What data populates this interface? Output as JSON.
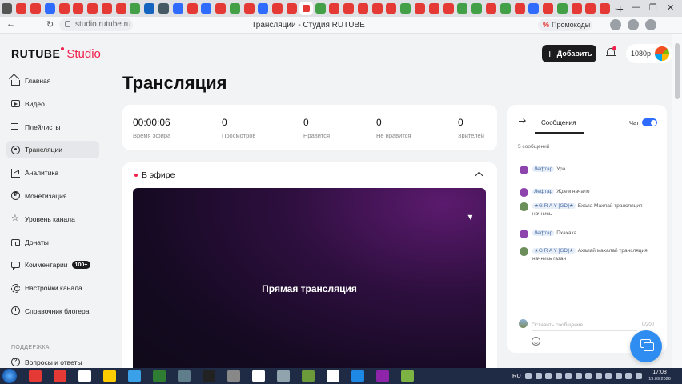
{
  "browser": {
    "tab_colors": [
      "#555",
      "#e53935",
      "#e53935",
      "#2f6bff",
      "#e53935",
      "#e53935",
      "#e53935",
      "#e53935",
      "#e53935",
      "#43a047",
      "#1565c0",
      "#455a64",
      "#2f6bff",
      "#e53935",
      "#2f6bff",
      "#e53935",
      "#43a047",
      "#e53935",
      "#2f6bff",
      "#e53935",
      "#e53935",
      "#e53935",
      "#43a047",
      "#e53935",
      "#e53935",
      "#e53935",
      "#e53935",
      "#e53935",
      "#43a047",
      "#e53935",
      "#e53935",
      "#e53935",
      "#43a047",
      "#43a047",
      "#e53935",
      "#43a047",
      "#e53935",
      "#2f6bff",
      "#e53935",
      "#43a047",
      "#e53935",
      "#e53935",
      "#e53935"
    ],
    "new_tab_icon": "+",
    "window_controls": [
      "↓",
      "—",
      "❐",
      "✕"
    ],
    "url": "studio.rutube.ru",
    "page_title": "Трансляции - Студия RUTUBE",
    "promo_label": "Промокоды",
    "promo_icon": "%",
    "nav_icons": [
      "←",
      "↻"
    ]
  },
  "header": {
    "logo_text": "RUTUBE",
    "logo_suffix": "Studio",
    "add_button_label": "Добавить",
    "add_button_icon": "+",
    "balance": "1080р",
    "accent_color": "#f1204b"
  },
  "sidebar": {
    "items": [
      {
        "label": "Главная",
        "icon": "house-icon"
      },
      {
        "label": "Видео",
        "icon": "video-icon"
      },
      {
        "label": "Плейлисты",
        "icon": "playlist-icon"
      },
      {
        "label": "Трансляции",
        "icon": "broadcast-icon",
        "active": true
      },
      {
        "label": "Аналитика",
        "icon": "chart-icon"
      },
      {
        "label": "Монетизация",
        "icon": "coin-icon"
      },
      {
        "label": "Уровень канала",
        "icon": "star-icon"
      },
      {
        "label": "Донаты",
        "icon": "wallet-icon"
      },
      {
        "label": "Комментарии",
        "icon": "comment-icon",
        "badge": "100+"
      },
      {
        "label": "Настройки канала",
        "icon": "gear-icon"
      },
      {
        "label": "Справочник блогера",
        "icon": "info-icon"
      }
    ],
    "support_title": "ПОДДЕРЖКА",
    "faq_label": "Вопросы и ответы"
  },
  "main": {
    "page_title": "Трансляция",
    "stats": [
      {
        "value": "00:00:06",
        "label": "Время эфира"
      },
      {
        "value": "0",
        "label": "Просмотров"
      },
      {
        "value": "0",
        "label": "Нравится"
      },
      {
        "value": "0",
        "label": "Не нравится"
      },
      {
        "value": "0",
        "label": "Зрителей"
      }
    ],
    "live_status": "В эфире",
    "player_label": "Прямая трансляция"
  },
  "chat": {
    "tab_label": "Сообщения",
    "toggle_label": "Чат",
    "toggle_on": true,
    "message_count": "5 сообщений",
    "messages": [
      {
        "author": "Лефтар",
        "text": "Ура",
        "avatar_color": "#8e44ad"
      },
      {
        "author": "Лефтар",
        "text": "Ждем начало",
        "avatar_color": "#8e44ad"
      },
      {
        "author": "★G R A Y [GD]★",
        "text": "Ехала Махлай трансляция начнись",
        "avatar_color": "#6b8e5a"
      },
      {
        "author": "Лефтар",
        "text": "Пхахаха",
        "avatar_color": "#8e44ad"
      },
      {
        "author": "★G R A Y [GD]★",
        "text": "Ахалай махалай трансляция начнись газан",
        "avatar_color": "#6b8e5a"
      }
    ],
    "input_placeholder": "Оставить сообщение...",
    "char_counter": "0/200"
  },
  "taskbar": {
    "app_colors": [
      "#e53935",
      "#e53935",
      "#fff",
      "#ffcc00",
      "#3aa0e8",
      "#2e7d32",
      "#607d8b",
      "#222",
      "#888",
      "#fff",
      "#90a4ae",
      "#6a9a3a",
      "#fff",
      "#1e88e5",
      "#8e24aa",
      "#7cb342"
    ],
    "language": "RU",
    "time": "17:08",
    "date": "19.09.2026"
  }
}
